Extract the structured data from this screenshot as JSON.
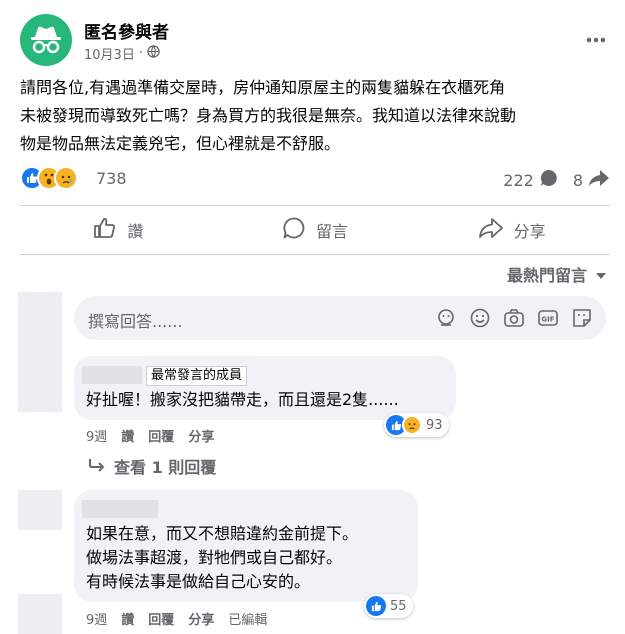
{
  "post": {
    "author": "匿名參與者",
    "date": "10月3日",
    "text_lines": [
      "請問各位,有遇過準備交屋時，房仲通知原屋主的兩隻貓躲在衣櫃死角",
      "未被發現而導致死亡嗎？身為買方的我很是無奈。我知道以法律來說動",
      "物是物品無法定義兇宅，但心裡就是不舒服。"
    ],
    "reaction_count": "738",
    "comment_count": "222",
    "share_count": "8"
  },
  "actions": {
    "like": "讚",
    "comment": "留言",
    "share": "分享"
  },
  "sort_label": "最熱門留言",
  "composer": {
    "placeholder": "撰寫回答......"
  },
  "comments": [
    {
      "badge": "最常發言的成員",
      "lines": [
        "好扯喔！搬家沒把貓帶走，而且還是2隻......"
      ],
      "time": "9週",
      "like": "讚",
      "reply": "回覆",
      "share": "分享",
      "reactions": "93",
      "view_replies": "查看 1 則回覆"
    },
    {
      "lines": [
        "如果在意，而又不想賠違約金前提下。",
        "做場法事超渡，對牠們或自己都好。",
        "有時候法事是做給自己心安的。"
      ],
      "time": "9週",
      "like": "讚",
      "reply": "回覆",
      "share": "分享",
      "edited": "已編輯",
      "reactions": "55"
    }
  ],
  "colors": {
    "avatar": "#27b77a",
    "like_blue": "#1877f2",
    "haha_yellow": "#f7b125",
    "text_secondary": "#65676b"
  },
  "icons": [
    "incognito-avatar",
    "globe-icon",
    "more-icon",
    "like-icon",
    "wow-icon",
    "sad-icon",
    "comment-icon",
    "share-icon",
    "chevron-down-icon",
    "sticker-icon",
    "emoji-icon",
    "camera-icon",
    "gif-icon",
    "avatar-sticker-icon",
    "reply-arrow-icon"
  ]
}
